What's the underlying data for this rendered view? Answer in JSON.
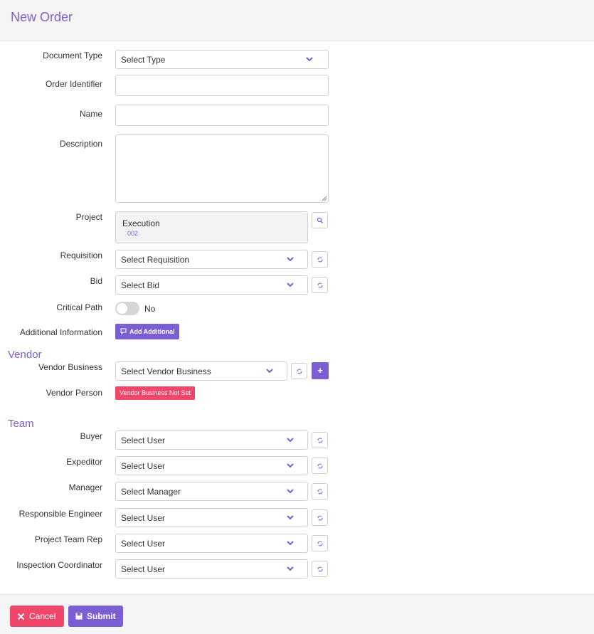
{
  "header": {
    "title": "New Order"
  },
  "form": {
    "document_type": {
      "label": "Document Type",
      "value": "Select Type"
    },
    "order_identifier": {
      "label": "Order Identifier",
      "value": ""
    },
    "name": {
      "label": "Name",
      "value": ""
    },
    "description": {
      "label": "Description",
      "value": ""
    },
    "project": {
      "label": "Project",
      "name": "Execution",
      "code": "002"
    },
    "requisition": {
      "label": "Requisition",
      "value": "Select Requisition"
    },
    "bid": {
      "label": "Bid",
      "value": "Select Bid"
    },
    "critical_path": {
      "label": "Critical Path",
      "state": "No",
      "enabled": false
    },
    "additional_information": {
      "label": "Additional Information",
      "button_label": "Add Additional"
    }
  },
  "vendor": {
    "section_title": "Vendor",
    "business": {
      "label": "Vendor Business",
      "value": "Select Vendor Business",
      "add_label": "+"
    },
    "person": {
      "label": "Vendor Person",
      "badge": "Vendor Business Not Set"
    }
  },
  "team": {
    "section_title": "Team",
    "buyer": {
      "label": "Buyer",
      "value": "Select User"
    },
    "expeditor": {
      "label": "Expeditor",
      "value": "Select User"
    },
    "manager": {
      "label": "Manager",
      "value": "Select Manager"
    },
    "responsible_engineer": {
      "label": "Responsible Engineer",
      "value": "Select User"
    },
    "project_team_rep": {
      "label": "Project Team Rep",
      "value": "Select User"
    },
    "inspection_coordinator": {
      "label": "Inspection Coordinator",
      "value": "Select User"
    }
  },
  "footer": {
    "cancel_label": "Cancel",
    "submit_label": "Submit"
  },
  "colors": {
    "accent": "#7b5ed3",
    "danger": "#f0466a",
    "header_bg": "#f5f5f5"
  },
  "icons": {
    "dropdown": "chevron-down-icon",
    "refresh": "refresh-icon",
    "search": "search-icon",
    "comment": "comment-icon",
    "cancel": "close-icon",
    "submit": "save-icon"
  }
}
